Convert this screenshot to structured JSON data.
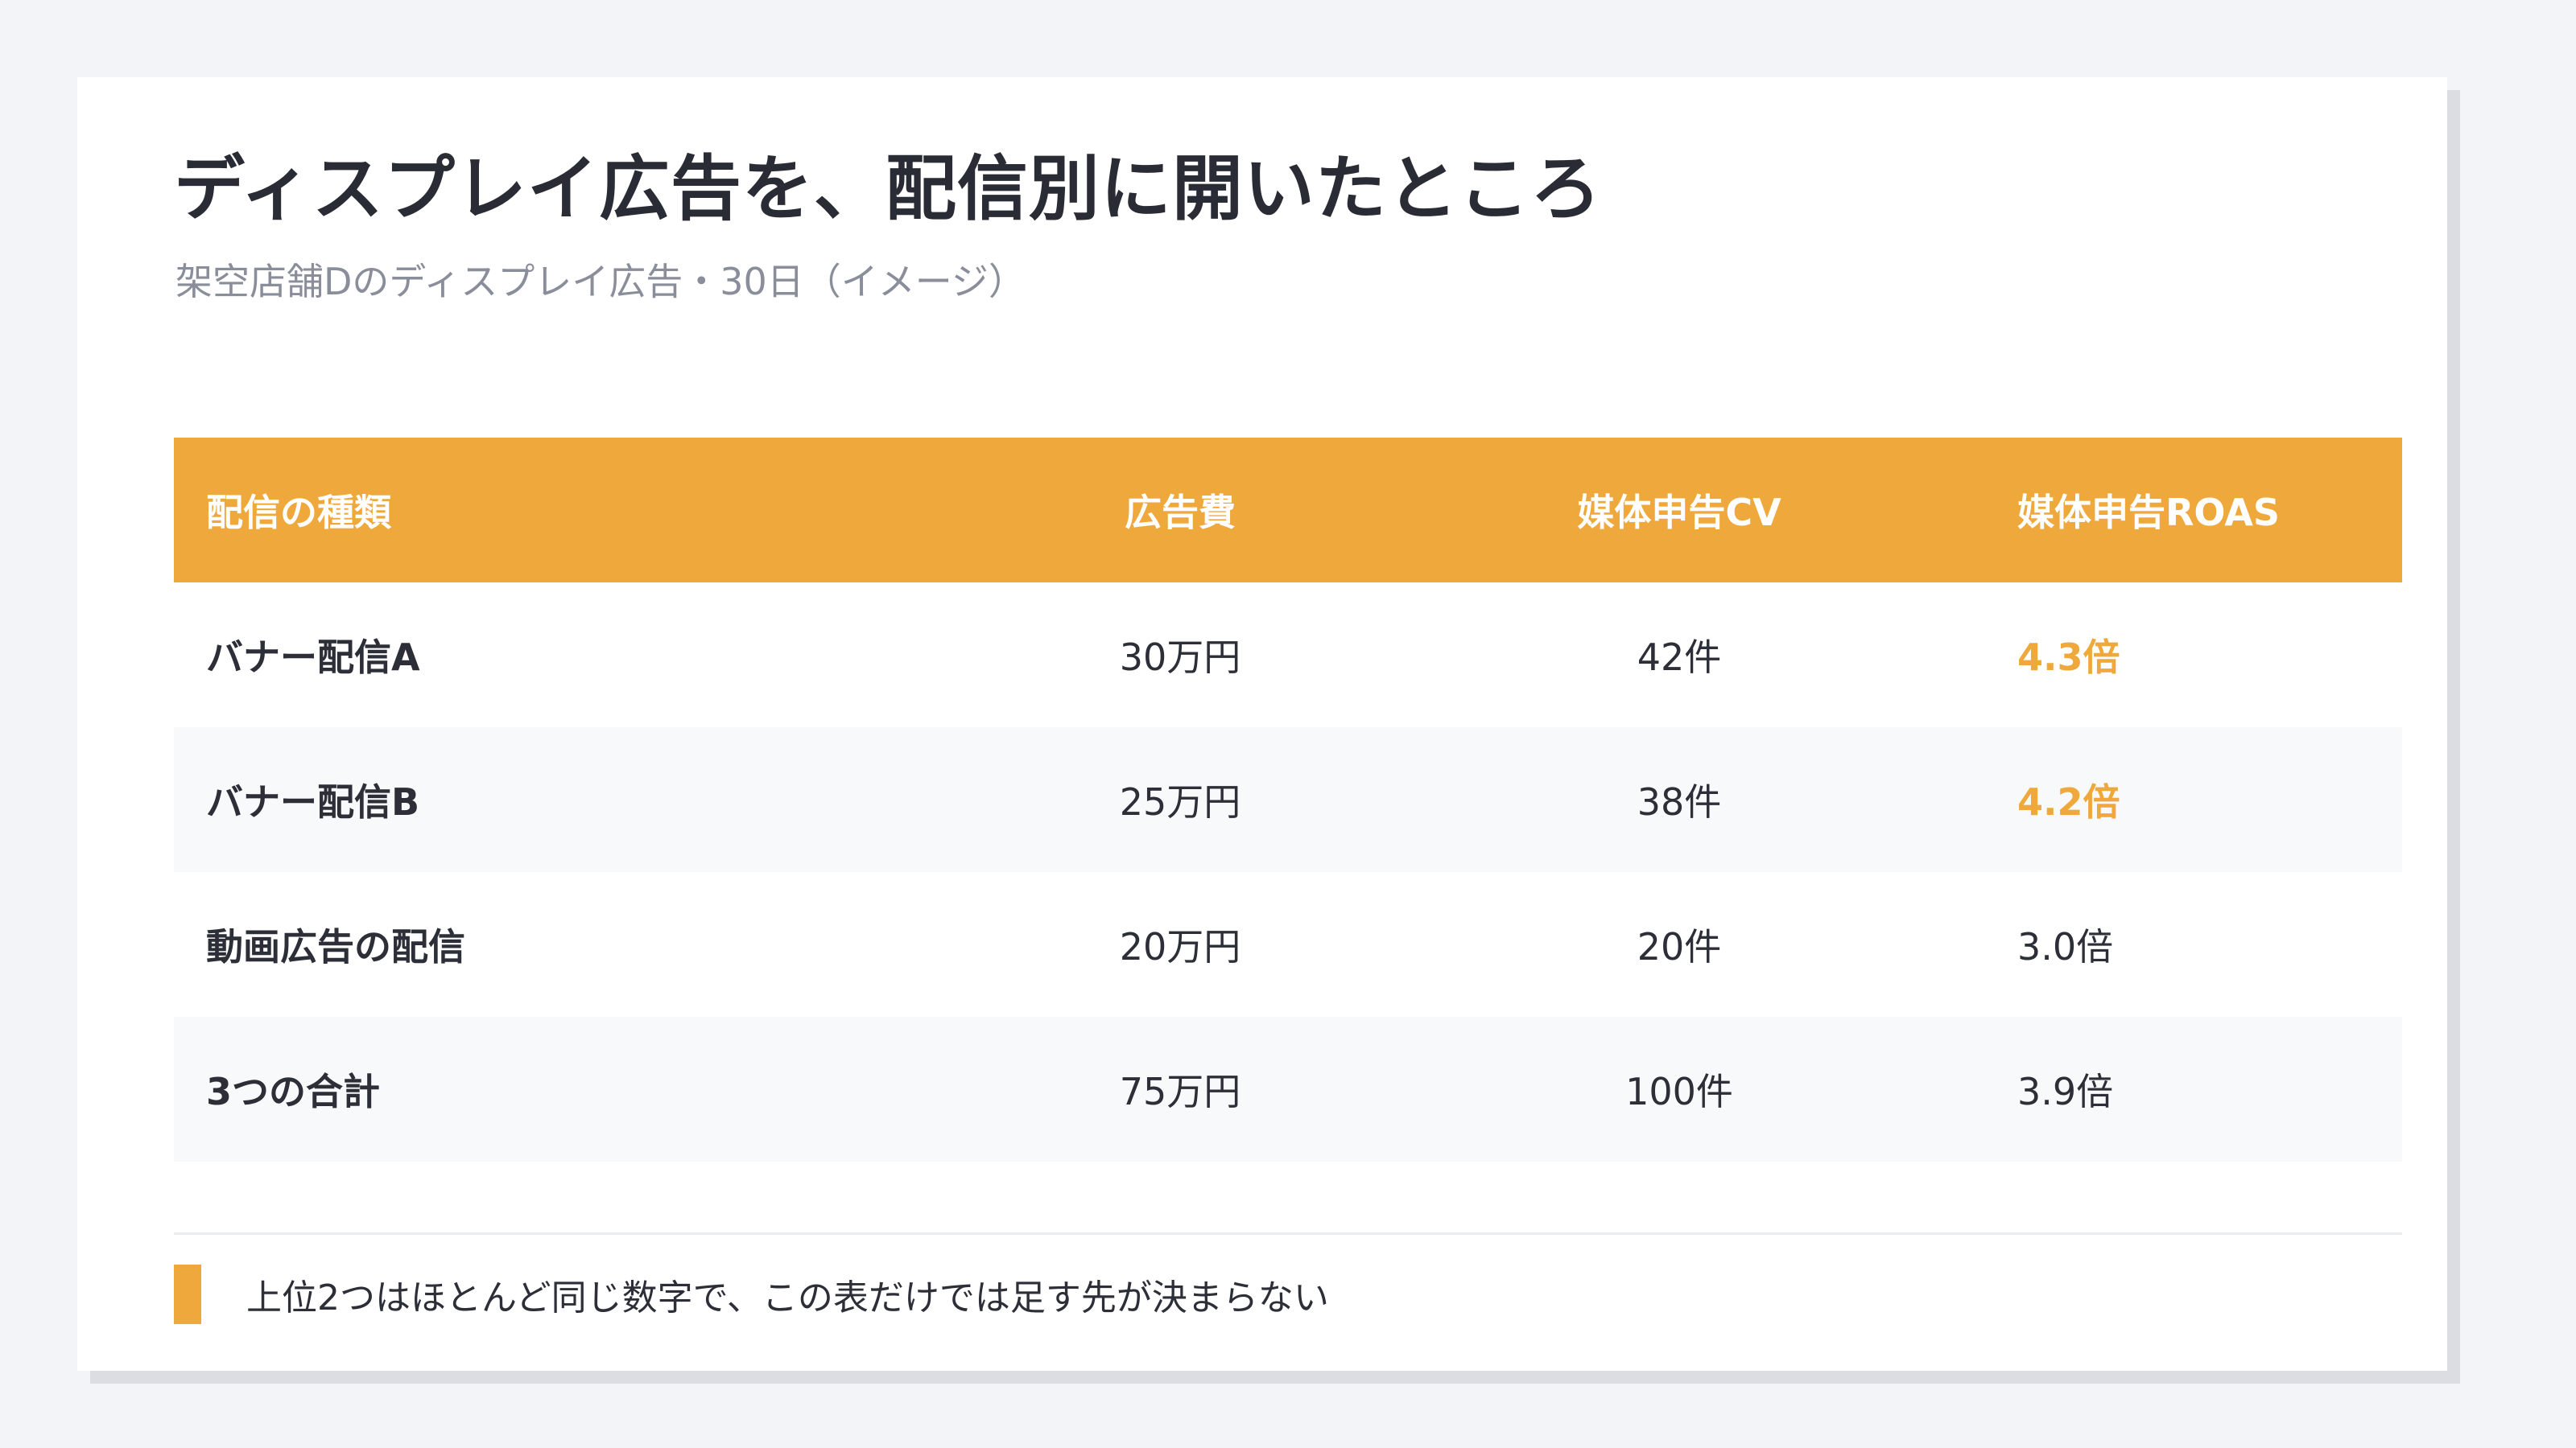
{
  "title": "ディスプレイ広告を、配信別に開いたところ",
  "subtitle": "架空店舗Dのディスプレイ広告・30日（イメージ）",
  "table": {
    "headers": [
      "配信の種類",
      "広告費",
      "媒体申告CV",
      "媒体申告ROAS"
    ],
    "rows": [
      [
        "バナー配信A",
        "30万円",
        "42件",
        "4.3倍"
      ],
      [
        "バナー配信B",
        "25万円",
        "38件",
        "4.2倍"
      ],
      [
        "動画広告の配信",
        "20万円",
        "20件",
        "3.0倍"
      ],
      [
        "3つの合計",
        "75万円",
        "100件",
        "3.9倍"
      ]
    ],
    "highlighted_rows": [
      0,
      1
    ]
  },
  "note": "上位2つはほとんど同じ数字で、この表だけでは足す先が決まらない",
  "colors": {
    "accent": "#efa83c",
    "text": "#2d2f38",
    "muted": "#8a8e9b",
    "row_alt": "#f8f9fb"
  }
}
